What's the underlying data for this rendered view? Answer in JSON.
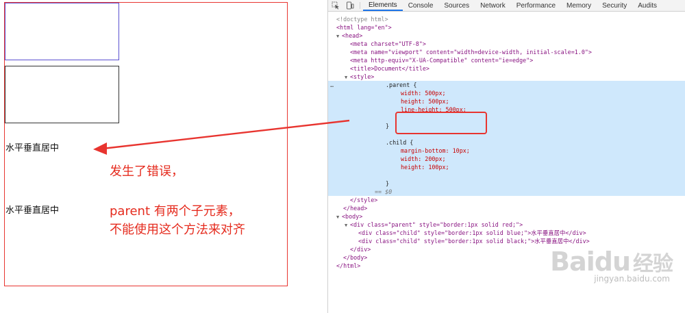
{
  "page": {
    "child_text_1": "水平垂直居中",
    "child_text_2": "水平垂直居中",
    "annotation": {
      "line1": "发生了错误，",
      "line2": "parent 有两个子元素，",
      "line3": "不能使用这个方法来对齐"
    }
  },
  "devtools": {
    "tabs": [
      "Elements",
      "Console",
      "Sources",
      "Network",
      "Performance",
      "Memory",
      "Security",
      "Audits"
    ],
    "active_tab": "Elements",
    "code": {
      "doctype": "<!doctype html>",
      "html_open": "<html lang=\"en\">",
      "head_open": "<head>",
      "meta_charset": "<meta charset=\"UTF-8\">",
      "meta_viewport": "<meta name=\"viewport\" content=\"width=device-width, initial-scale=1.0\">",
      "meta_compat": "<meta http-equiv=\"X-UA-Compatible\" content=\"ie=edge\">",
      "title": "<title>Document</title>",
      "style_open": "<style>",
      "ellipsis": "…",
      "parent_sel": ".parent {",
      "parent_width": "width: 500px;",
      "parent_height": "height: 500px;",
      "parent_line_height": "line-height: 500px;",
      "close_brace_1": "}",
      "child_sel": ".child {",
      "child_margin": "margin-bottom: 10px;",
      "child_width": "width: 200px;",
      "child_height": "height: 100px;",
      "close_brace_2": "}",
      "dollar": "== $0",
      "style_close": "</style>",
      "head_close": "</head>",
      "body_open": "<body>",
      "div_parent": "<div class=\"parent\" style=\"border:1px solid red;\">",
      "div_child_1": "<div class=\"child\" style=\"border:1px solid blue;\">水平垂直居中</div>",
      "div_child_2": "<div class=\"child\" style=\"border:1px solid black;\">水平垂直居中</div>",
      "div_close": "</div>",
      "body_close": "</body>",
      "html_close": "</html>"
    }
  },
  "watermark": {
    "logo": "Baidu",
    "logo_cn": "经验",
    "url": "jingyan.baidu.com"
  },
  "colors": {
    "annotation_red": "#e52b1e",
    "selection_blue": "#cfe8fc",
    "active_tab_blue": "#1a73e8"
  },
  "icons": [
    "inspect-cursor-icon",
    "device-toolbar-icon"
  ]
}
